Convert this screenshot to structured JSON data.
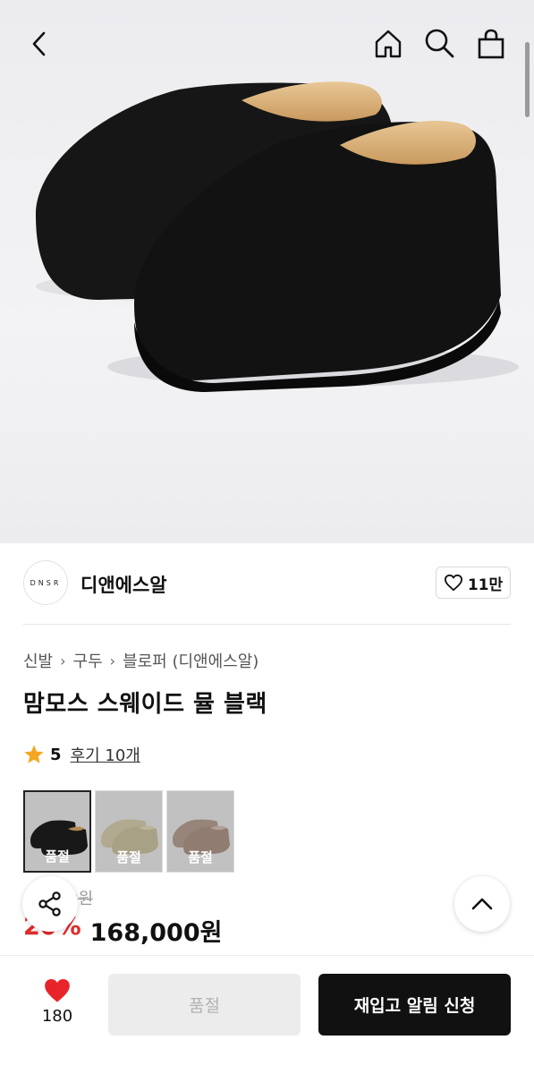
{
  "brand": {
    "logo_text": "DNSR",
    "name": "디앤에스알"
  },
  "likes": {
    "count": "11만"
  },
  "breadcrumb": [
    "신발",
    "구두",
    "블로퍼 (디앤에스알)"
  ],
  "product": {
    "title": "맘모스 스웨이드 뮬 블랙"
  },
  "rating": {
    "score": "5",
    "reviews": "후기 10개"
  },
  "swatches": [
    {
      "label": "품절",
      "color": "#1e1e1e"
    },
    {
      "label": "품절",
      "color": "#d8cfb0"
    },
    {
      "label": "품절",
      "color": "#b9a295"
    }
  ],
  "price": {
    "original": "0원",
    "discount": "20%",
    "final": "168,000원"
  },
  "bottom": {
    "heart_count": "180",
    "soldout_label": "품절",
    "notify_label": "재입고 알림 신청"
  },
  "colors": {
    "accent_red": "#e02b2b",
    "heart_red": "#e8242b",
    "star": "#f5a623"
  }
}
